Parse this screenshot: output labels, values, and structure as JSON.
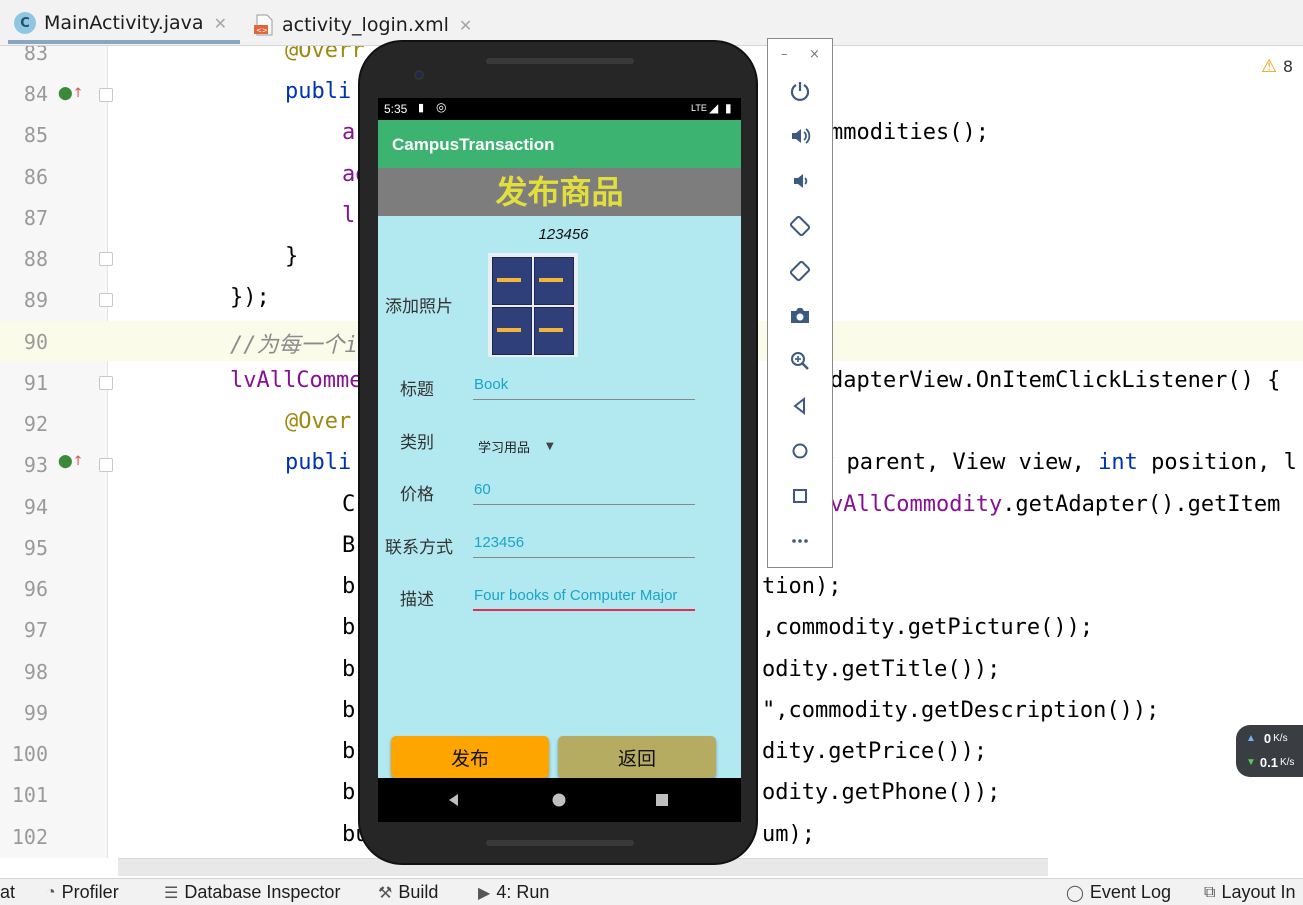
{
  "tabs": [
    {
      "label": "MainActivity.java",
      "icon": "java-class-icon"
    },
    {
      "label": "activity_login.xml",
      "icon": "xml-layout-icon"
    }
  ],
  "editor": {
    "warning_count": "8",
    "lines": [
      {
        "num": "83",
        "code": "@Overr"
      },
      {
        "num": "84",
        "code": "publi"
      },
      {
        "num": "85",
        "code": "a",
        "right": "mmodities();"
      },
      {
        "num": "86",
        "code": "ad"
      },
      {
        "num": "87",
        "code": "l"
      },
      {
        "num": "88",
        "code": "}"
      },
      {
        "num": "89",
        "code": "});"
      },
      {
        "num": "90",
        "code": "//为每一个i"
      },
      {
        "num": "91",
        "code": "lvAllComme",
        "right": "dapterView.OnItemClickListener() {"
      },
      {
        "num": "92",
        "code": "@Over"
      },
      {
        "num": "93",
        "code": "publi",
        "right_a": "w parent, View view, ",
        "right_kw": "int",
        "right_b": " position, l"
      },
      {
        "num": "94",
        "code": "C",
        "right_fld": "vAllCommodity",
        "right_b": ".getAdapter().getItem"
      },
      {
        "num": "95",
        "code": "B"
      },
      {
        "num": "96",
        "code": "b",
        "right": "tion);"
      },
      {
        "num": "97",
        "code": "b",
        "right": ",commodity.getPicture());"
      },
      {
        "num": "98",
        "code": "b",
        "right": "odity.getTitle());"
      },
      {
        "num": "99",
        "code": "b",
        "right": "\",commodity.getDescription());"
      },
      {
        "num": "100",
        "code": "b",
        "right": "dity.getPrice());"
      },
      {
        "num": "101",
        "code": "b",
        "right": "odity.getPhone());"
      },
      {
        "num": "102",
        "code": "bu",
        "right": "um);"
      }
    ]
  },
  "bottom_tools": [
    "at",
    "Profiler",
    "Database Inspector",
    "Build",
    "4: Run",
    "Event Log",
    "Layout In"
  ],
  "network": {
    "up": "0",
    "up_unit": "K/s",
    "down": "0.1",
    "down_unit": "K/s"
  },
  "emulator_toolbar": {
    "minimize": "–",
    "close": "×",
    "buttons": [
      "power-icon",
      "volume-up-icon",
      "volume-down-icon",
      "rotate-left-icon",
      "rotate-right-icon",
      "camera-icon",
      "zoom-icon",
      "back-icon",
      "home-icon",
      "overview-icon",
      "more-icon"
    ]
  },
  "phone": {
    "status_time": "5:35",
    "status_right": "LTE",
    "app_title": "CampusTransaction",
    "banner": "发布商品",
    "user_id": "123456",
    "form": {
      "photo_label": "添加照片",
      "title_label": "标题",
      "title_value": "Book",
      "category_label": "类别",
      "category_value": "学习用品",
      "price_label": "价格",
      "price_value": "60",
      "contact_label": "联系方式",
      "contact_value": "123456",
      "desc_label": "描述",
      "desc_value": "Four books of Computer Major"
    },
    "publish_button": "发布",
    "back_button": "返回",
    "colors": {
      "app_bar": "#3cb371",
      "banner_bg": "#7d7d7d",
      "banner_text": "#e2df3c",
      "content_bg": "#b2e8f0",
      "publish_bg": "#ffa500",
      "back_bg": "#b5ac62"
    }
  }
}
